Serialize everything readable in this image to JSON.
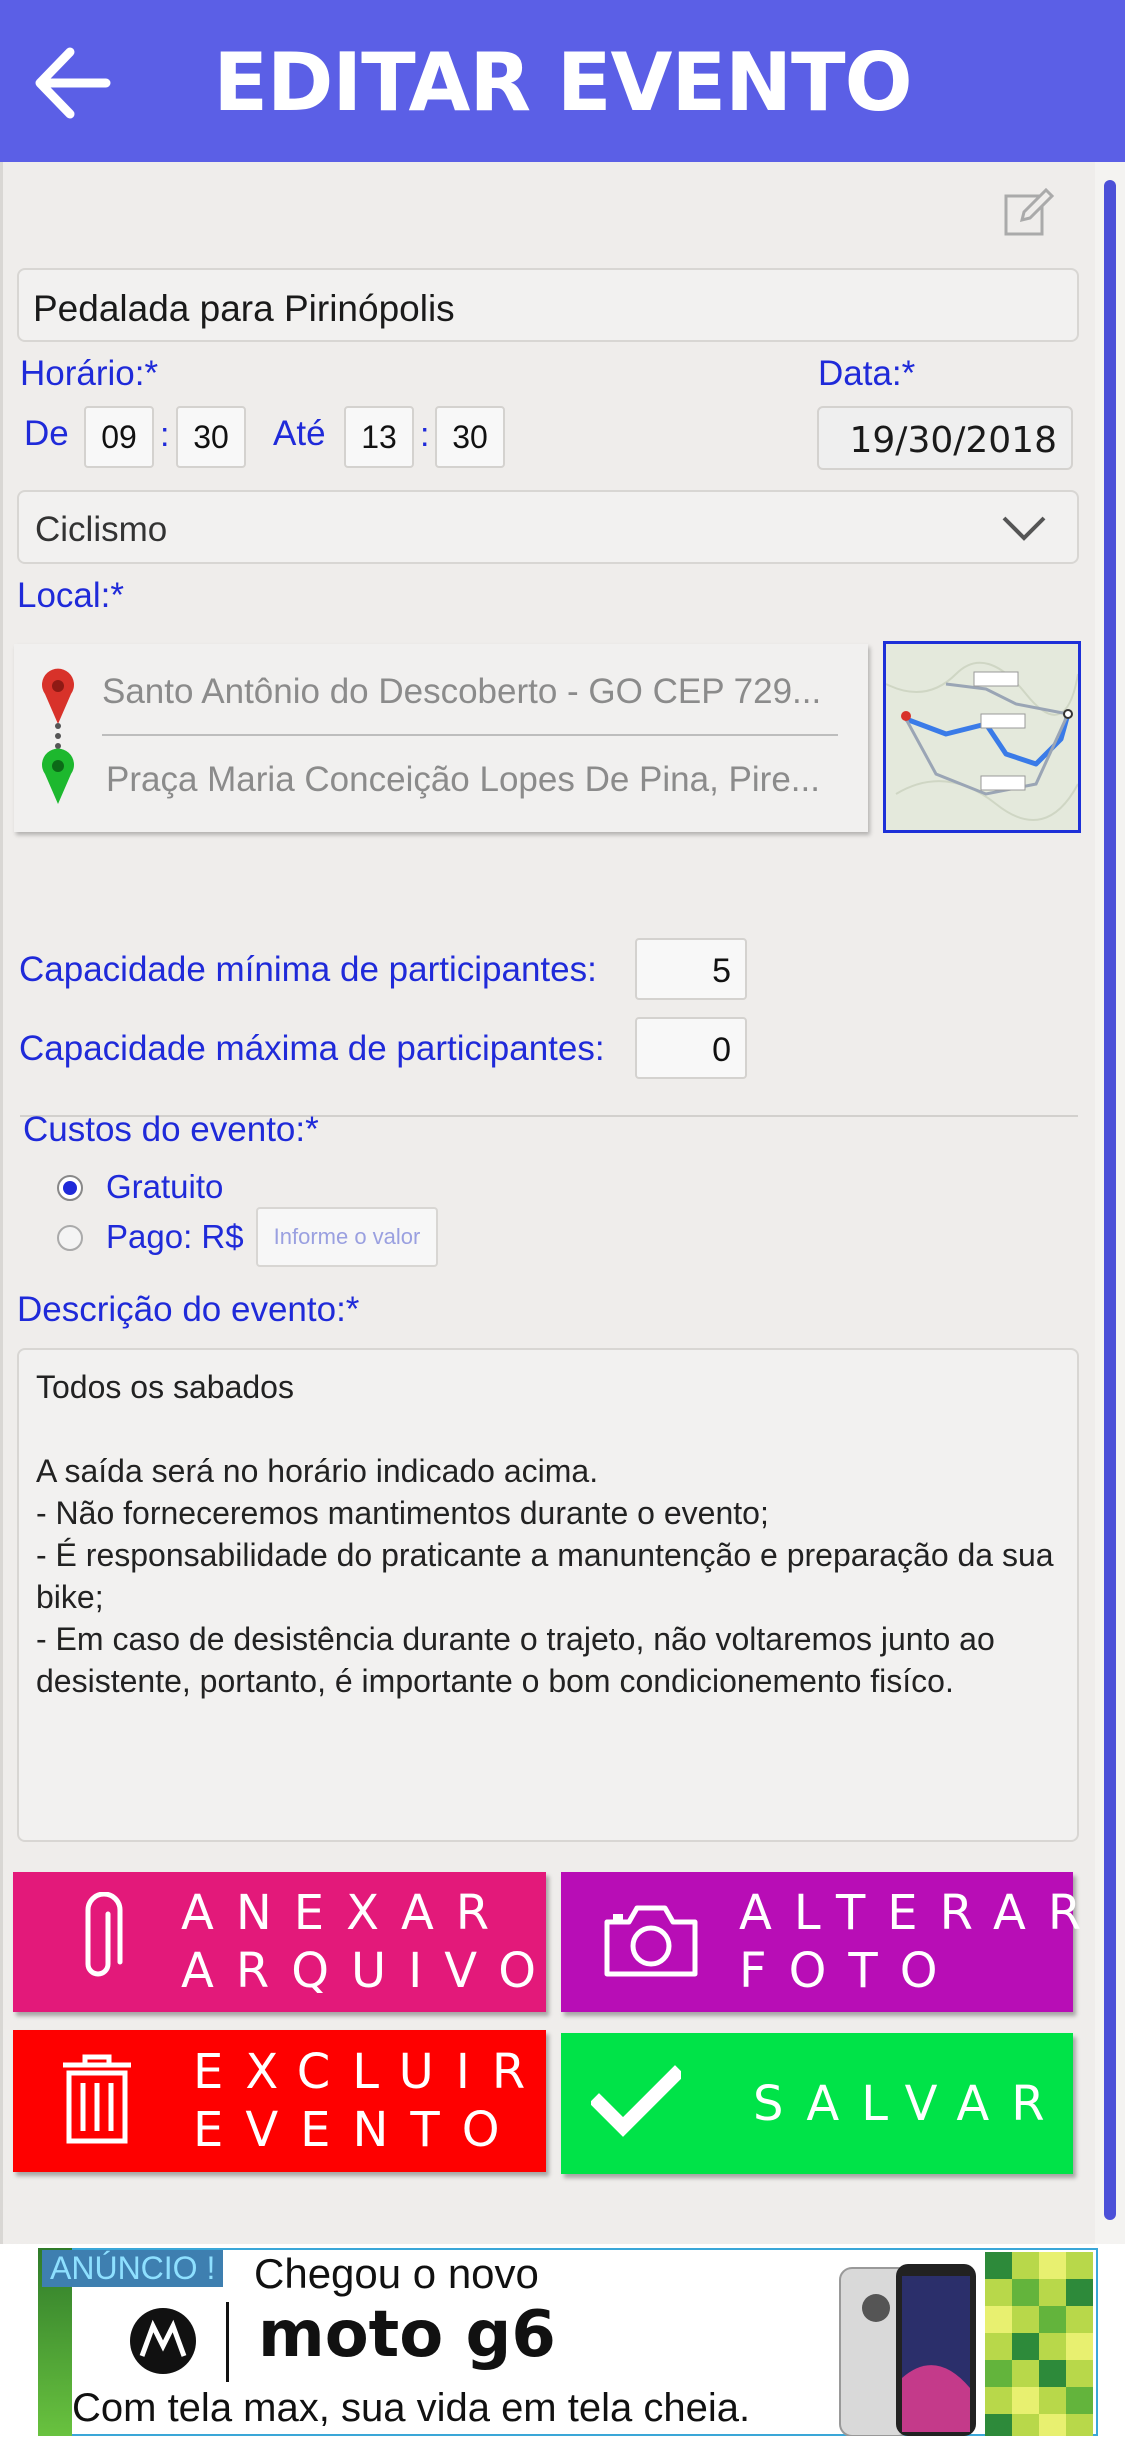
{
  "header": {
    "title": "EDITAR EVENTO",
    "back_icon": "arrow-left-icon",
    "background": "#5b5fe6"
  },
  "event": {
    "name": "Pedalada para Pirinópolis",
    "horario_label": "Horário:*",
    "data_label": "Data:*",
    "de_label": "De",
    "ate_label": "Até",
    "start_hour": "09",
    "start_minute": "30",
    "end_hour": "13",
    "end_minute": "30",
    "colon": ":",
    "date": "19/30/2018",
    "sport": "Ciclismo"
  },
  "local": {
    "label": "Local:*",
    "origin": "Santo Antônio do Descoberto - GO CEP 729...",
    "destination": "Praça Maria Conceição Lopes De Pina, Pire..."
  },
  "capacity": {
    "min_label": "Capacidade mínima de participantes:",
    "min_value": "5",
    "max_label": "Capacidade máxima de participantes:",
    "max_value": "0"
  },
  "costs": {
    "label": "Custos do evento:*",
    "free_label": "Gratuito",
    "paid_label": "Pago: R$",
    "selected": "Gratuito",
    "value_placeholder": "Informe o valor"
  },
  "description": {
    "label": "Descrição do evento:*",
    "text": "Todos os sabados\n\nA saída será no horário indicado acima.\n- Não forneceremos mantimentos durante o evento;\n- É responsabilidade do praticante a manuntenção e preparação da sua bike;\n- Em caso de desistência durante o trajeto, não voltaremos junto ao desistente, portanto, é importante o bom condicionemento fisíco."
  },
  "buttons": {
    "attach": {
      "line1": "ANEXAR",
      "line2": "ARQUIVO",
      "icon": "paperclip-icon",
      "color": "#e3197a"
    },
    "photo": {
      "line1": "ALTERAR",
      "line2": "FOTO",
      "icon": "camera-icon",
      "color": "#b80db6"
    },
    "delete": {
      "line1": "EXCLUIR",
      "line2": "EVENTO",
      "icon": "trash-icon",
      "color": "#fe0000"
    },
    "save": {
      "label": "SALVAR",
      "icon": "checkmark-icon",
      "color": "#00e348"
    }
  },
  "ad": {
    "badge": "ANÚNCIO !",
    "headline": "Chegou o novo",
    "brand": "moto g6",
    "subtext": "Com tela max, sua vida em tela cheia."
  }
}
